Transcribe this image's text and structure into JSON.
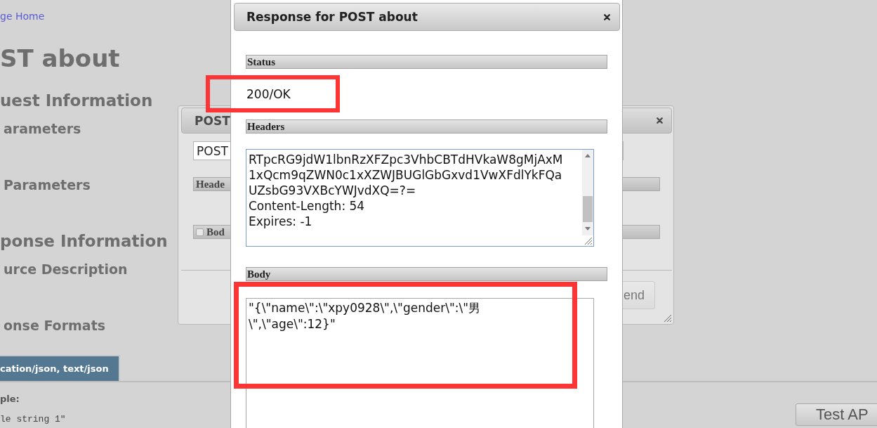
{
  "page": {
    "breadcrumb_link": "ge Home",
    "title": "ST about",
    "sections": [
      {
        "kind": "h2",
        "text": "uest Information"
      },
      {
        "kind": "h3",
        "text": "arameters"
      },
      {
        "kind": "h3",
        "text": "Parameters"
      },
      {
        "kind": "h2",
        "text": "ponse Information"
      },
      {
        "kind": "h3",
        "text": "urce Description"
      },
      {
        "kind": "h3",
        "text": "onse Formats"
      }
    ],
    "format_tabs": [
      {
        "label": "cation/json, text/json",
        "selected": true
      }
    ],
    "sample_label": "ple:",
    "sample_text": "le string 1\"",
    "test_button": "Test AP"
  },
  "request_dialog": {
    "title": "POST",
    "method_value": "POST",
    "headers_label": "Heade",
    "body_checkbox": {
      "label": "Bod",
      "checked": false
    },
    "send_button": "end"
  },
  "response_dialog": {
    "title": "Response for POST about",
    "status": {
      "label": "Status",
      "value": "200/OK",
      "highlighted": true
    },
    "headers": {
      "label": "Headers",
      "lines": [
        "RTpcRG9jdW1lbnRzXFZpc3VhbCBTdHVkaW8gMjAxM",
        "1xQcm9qZWN0c1xXZWJBUGlGbGxvd1VwXFdlYkFQa",
        "UZsbG93VXBcYWJvdXQ=?=",
        "Content-Length: 54",
        "Expires: -1"
      ]
    },
    "body": {
      "label": "Body",
      "lines": [
        "\"{\\\"name\\\":\\\"xpy0928\\\",\\\"gender\\\":\\\"男",
        "\\\",\\\"age\\\":12}\""
      ],
      "highlighted": true
    }
  }
}
